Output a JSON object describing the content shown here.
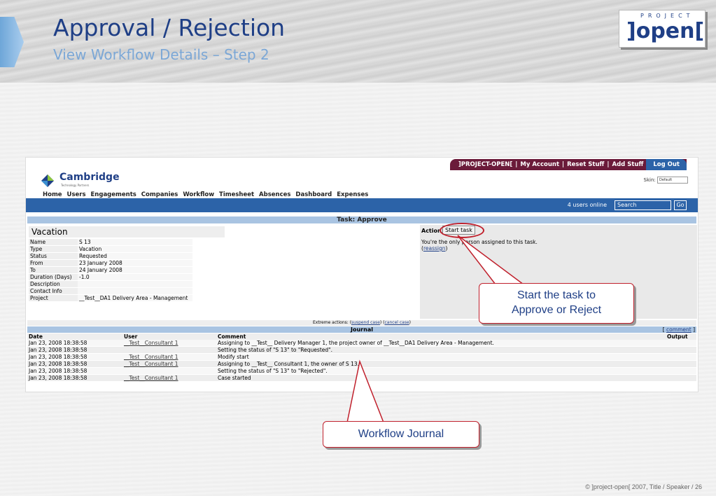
{
  "slide": {
    "title": "Approval / Rejection",
    "subtitle": "View Workflow Details – Step 2",
    "brand_small": "PROJECT",
    "brand_big": "]open[",
    "footer": "©  ]project-open[  2007, Title / Speaker / 26"
  },
  "app": {
    "logo_name": "Cambridge",
    "logo_tag": "Technology Partners",
    "topbar": {
      "brand": "]PROJECT-OPEN[",
      "my_account": "My Account",
      "reset_stuff": "Reset Stuff",
      "add_stuff": "Add Stuff",
      "logout": "Log Out"
    },
    "skin_label": "Skin:",
    "skin_value": "Default",
    "nav": [
      "Home",
      "Users",
      "Engagements",
      "Companies",
      "Workflow",
      "Timesheet",
      "Absences",
      "Dashboard",
      "Expenses"
    ],
    "users_online": "4 users online",
    "search_placeholder": "Search",
    "go": "Go",
    "task_title": "Task: Approve",
    "vacation": "Vacation",
    "fields": [
      {
        "k": "Name",
        "v": "S 13"
      },
      {
        "k": "Type",
        "v": "Vacation"
      },
      {
        "k": "Status",
        "v": "Requested"
      },
      {
        "k": "From",
        "v": "23 January 2008"
      },
      {
        "k": "To",
        "v": "24 January 2008"
      },
      {
        "k": "Duration (Days)",
        "v": "-1.0"
      },
      {
        "k": "Description",
        "v": ""
      },
      {
        "k": "Contact Info",
        "v": ""
      },
      {
        "k": "Project",
        "v": "__Test__DA1 Delivery Area - Management"
      }
    ],
    "action_label": "Action:",
    "start_task": "Start task",
    "only_person": "You're the only person assigned to this task.",
    "reassign_open": "(",
    "reassign": "reassign",
    "reassign_close": ")",
    "extreme_label": "Extreme actions:",
    "suspend_case": "suspend case",
    "cancel_case": "cancel case",
    "journal_title": "Journal",
    "comment_link": "comment",
    "journal_cols": [
      "Date",
      "User",
      "Comment",
      "Output"
    ],
    "journal_rows": [
      {
        "date": "Jan 23, 2008 18:38:58",
        "user": "__Test__Consultant 1",
        "comment": "Assigning to __Test__ Delivery Manager 1, the project owner of __Test__DA1 Delivery Area - Management."
      },
      {
        "date": "Jan 23, 2008 18:38:58",
        "user": "",
        "comment": "Setting the status of \"S 13\" to \"Requested\"."
      },
      {
        "date": "Jan 23, 2008 18:38:58",
        "user": "__Test__Consultant 1",
        "comment": "Modify start"
      },
      {
        "date": "Jan 23, 2008 18:38:58",
        "user": "__Test__Consultant 1",
        "comment": "Assigning to __Test__ Consultant 1, the owner of S 13."
      },
      {
        "date": "Jan 23, 2008 18:38:58",
        "user": "",
        "comment": "Setting the status of \"S 13\" to \"Rejected\"."
      },
      {
        "date": "Jan 23, 2008 18:38:58",
        "user": "__Test__Consultant 1",
        "comment": "Case started"
      }
    ]
  },
  "callouts": {
    "start_task_line1": "Start the task to",
    "start_task_line2": "Approve or Reject",
    "journal": "Workflow Journal"
  },
  "colors": {
    "title_blue": "#1f3f86",
    "nav_bar": "#2c63a8",
    "topbar": "#6b1b3a",
    "callout_red": "#c0202c"
  }
}
